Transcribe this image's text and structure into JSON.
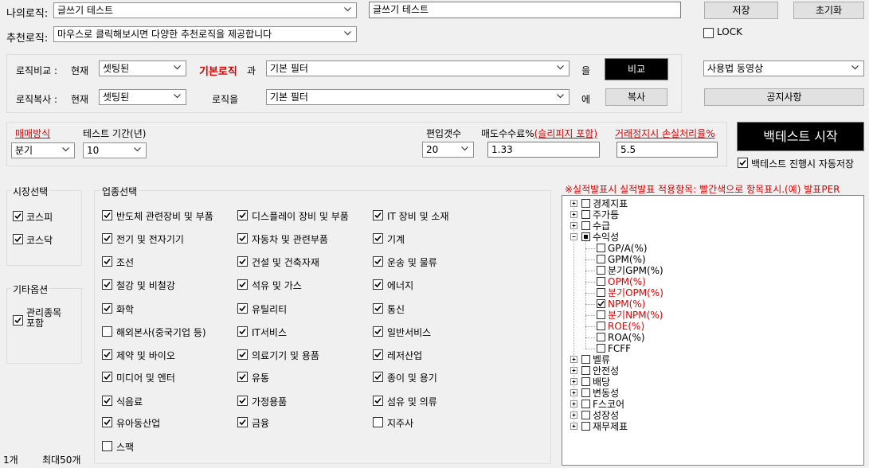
{
  "top": {
    "my_logic_label": "나의로직:",
    "my_logic_value": "글쓰기 테스트",
    "logic_name_input": "글쓰기 테스트",
    "save_label": "저장",
    "reset_label": "초기화",
    "recommend_label": "추천로직:",
    "recommend_value": "마우스로 클릭해보시면 다양한 추천로직을 제공합니다",
    "lock_label": "LOCK",
    "lock_checked": false
  },
  "compare": {
    "label": "로직비교 :",
    "current": "현재",
    "state_value": "셋팅된",
    "basic_logic": "기본로직",
    "particle_gwa": "과",
    "filter_value": "기본 필터",
    "particle_eul": "을",
    "button": "비교"
  },
  "copy": {
    "label": "로직복사 :",
    "current": "현재",
    "state_value": "셋팅된",
    "logic_eul": "로직을",
    "filter_value": "기본 필터",
    "particle_e": "에",
    "button": "복사"
  },
  "right": {
    "video_value": "사용법 동영상",
    "notice_label": "공지사항",
    "backtest_start": "백테스트 시작",
    "auto_save_label": "백테스트 진행시 자동저장",
    "auto_save_checked": true
  },
  "settings": {
    "trade_method_label": "매매방식",
    "trade_method_value": "분기",
    "test_period_label": "테스트 기간(년)",
    "test_period_value": "10",
    "count_label": "편입갯수",
    "count_value": "20",
    "fee_label_prefix": "매도수수료%",
    "fee_label_link": "(슬리피지 포함)",
    "fee_value": "1.33",
    "stoploss_label": "거래정지시 손실처리율%",
    "stoploss_value": "5.5"
  },
  "market": {
    "title": "시장선택",
    "items": [
      {
        "label": "코스피",
        "checked": true
      },
      {
        "label": "코스닥",
        "checked": true
      }
    ]
  },
  "other": {
    "title": "기타옵션",
    "label_line1": "관리종목",
    "label_line2": "포함",
    "checked": true
  },
  "sector": {
    "title": "업종선택",
    "columns": [
      [
        {
          "label": "반도체 관련장비 및 부품",
          "checked": true
        },
        {
          "label": "전기 및 전자기기",
          "checked": true
        },
        {
          "label": "조선",
          "checked": true
        },
        {
          "label": "철강 및 비철강",
          "checked": true
        },
        {
          "label": "화학",
          "checked": true
        },
        {
          "label": "해외본사(중국기업 등)",
          "checked": false
        },
        {
          "label": "제약 및 바이오",
          "checked": true
        },
        {
          "label": "미디어 및 엔터",
          "checked": true
        },
        {
          "label": "식음료",
          "checked": true
        },
        {
          "label": "유아동산업",
          "checked": true
        },
        {
          "label": "스팩",
          "checked": false
        }
      ],
      [
        {
          "label": "디스플레이 장비 및 부품",
          "checked": true
        },
        {
          "label": "자동차 및 관련부품",
          "checked": true
        },
        {
          "label": "건설 및 건축자재",
          "checked": true
        },
        {
          "label": "석유 및 가스",
          "checked": true
        },
        {
          "label": "유틸리티",
          "checked": true
        },
        {
          "label": "IT서비스",
          "checked": true
        },
        {
          "label": "의료기기 및 용품",
          "checked": true
        },
        {
          "label": "유통",
          "checked": true
        },
        {
          "label": "가정용품",
          "checked": true
        },
        {
          "label": "금융",
          "checked": true
        }
      ],
      [
        {
          "label": "IT 장비 및 소재",
          "checked": true
        },
        {
          "label": "기계",
          "checked": true
        },
        {
          "label": "운송 및 물류",
          "checked": true
        },
        {
          "label": "에너지",
          "checked": true
        },
        {
          "label": "통신",
          "checked": true
        },
        {
          "label": "일반서비스",
          "checked": true
        },
        {
          "label": "레저산업",
          "checked": true
        },
        {
          "label": "종이 및 용기",
          "checked": true
        },
        {
          "label": "섬유 및 의류",
          "checked": true
        },
        {
          "label": "지주사",
          "checked": false
        }
      ]
    ]
  },
  "tree": {
    "notice": "※실적발표시 실적발표 적용항목: 빨간색으로 항목표시.(예) 발표PER",
    "top_nodes": [
      {
        "label": "경제지표",
        "state": "unchecked"
      },
      {
        "label": "주가등",
        "state": "unchecked"
      },
      {
        "label": "수급",
        "state": "unchecked"
      },
      {
        "label": "수익성",
        "state": "partial"
      }
    ],
    "children": [
      {
        "label": "GP/A(%)",
        "checked": false,
        "red": false
      },
      {
        "label": "GPM(%)",
        "checked": false,
        "red": false
      },
      {
        "label": "분기GPM(%)",
        "checked": false,
        "red": false
      },
      {
        "label": "OPM(%)",
        "checked": false,
        "red": true
      },
      {
        "label": "분기OPM(%)",
        "checked": false,
        "red": true
      },
      {
        "label": "NPM(%)",
        "checked": true,
        "red": true
      },
      {
        "label": "분기NPM(%)",
        "checked": false,
        "red": true
      },
      {
        "label": "ROE(%)",
        "checked": false,
        "red": true
      },
      {
        "label": "ROA(%)",
        "checked": false,
        "red": false
      },
      {
        "label": "FCFF",
        "checked": false,
        "red": false
      }
    ],
    "bottom_nodes": [
      {
        "label": "벨류"
      },
      {
        "label": "안전성"
      },
      {
        "label": "배당"
      },
      {
        "label": "변동성"
      },
      {
        "label": "F스코어"
      },
      {
        "label": "성장성"
      },
      {
        "label": "재무제표"
      }
    ]
  },
  "status": {
    "count": "1개",
    "max": "최대50개"
  }
}
